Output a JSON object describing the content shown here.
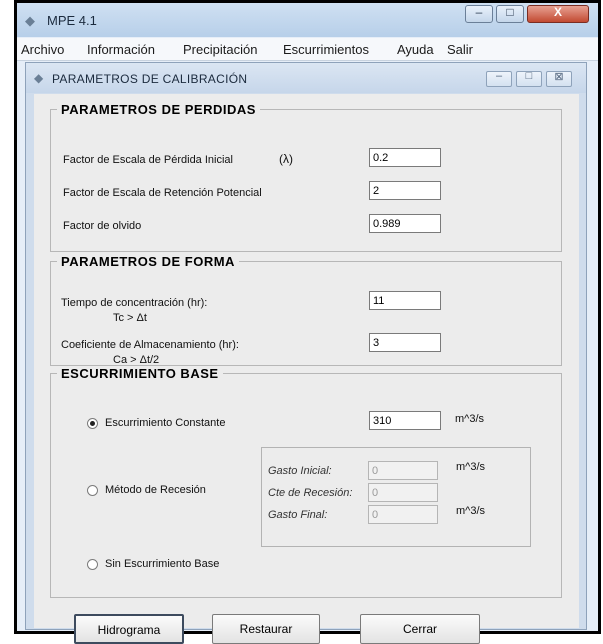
{
  "window": {
    "title": "MPE 4.1",
    "controls": {
      "minimize": "–",
      "maximize": "□",
      "close": "X"
    }
  },
  "menu": [
    "Archivo",
    "Información",
    "Precipitación",
    "Escurrimientos",
    "Ayuda",
    "Salir"
  ],
  "dialog": {
    "title": "PARAMETROS DE CALIBRACIÓN",
    "controls": {
      "minimize": "–",
      "maximize": "□",
      "close": "⊠"
    }
  },
  "perdidas": {
    "title": "PARAMETROS DE PERDIDAS",
    "lambda_symbol": "(λ)",
    "fields": [
      {
        "label": "Factor de Escala de Pérdida Inicial",
        "value": "0.2"
      },
      {
        "label": "Factor de Escala de Retención Potencial",
        "value": "2"
      },
      {
        "label": "Factor de olvido",
        "value": "0.989"
      }
    ]
  },
  "forma": {
    "title": "PARAMETROS DE FORMA",
    "fields": [
      {
        "label": "Tiempo de concentración (hr):",
        "sublabel": "Tc > Δt",
        "value": "11"
      },
      {
        "label": "Coeficiente de Almacenamiento (hr):",
        "sublabel": "Ca > Δt/2",
        "value": "3"
      }
    ]
  },
  "base": {
    "title": "ESCURRIMIENTO BASE",
    "options": [
      {
        "label": "Escurrimiento Constante",
        "selected": true,
        "value": "310",
        "unit": "m^3/s"
      },
      {
        "label": "Método de Recesión",
        "selected": false
      },
      {
        "label": "Sin Escurrimiento Base",
        "selected": false
      }
    ],
    "recesion": {
      "gasto_inicial": {
        "label": "Gasto Inicial:",
        "value": "0",
        "unit": "m^3/s"
      },
      "cte_recesion": {
        "label": "Cte de Recesión:",
        "value": "0"
      },
      "gasto_final": {
        "label": "Gasto Final:",
        "value": "0",
        "unit": "m^3/s"
      }
    }
  },
  "buttons": {
    "hidrograma": "Hidrograma",
    "restaurar": "Restaurar",
    "cerrar": "Cerrar"
  }
}
